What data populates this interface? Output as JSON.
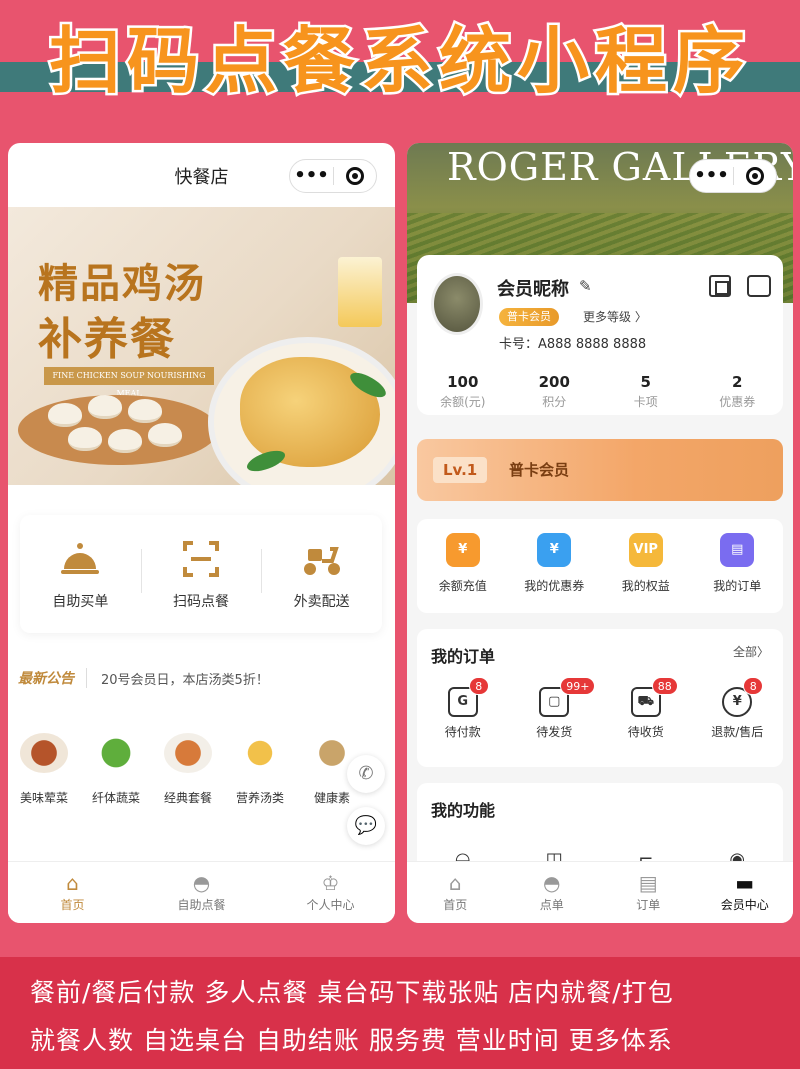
{
  "banner": {
    "title": "扫码点餐系统小程序"
  },
  "left_phone": {
    "title": "快餐店",
    "capsule": {
      "more_icon": "more-dots-icon",
      "close_icon": "target-icon"
    },
    "hero": {
      "line1": "精品鸡汤",
      "line2": "补养餐",
      "subtitle": "FINE CHICKEN SOUP NOURISHING MEAL"
    },
    "quick_actions": [
      {
        "label": "自助买单",
        "icon": "cloche-icon"
      },
      {
        "label": "扫码点餐",
        "icon": "scan-icon"
      },
      {
        "label": "外卖配送",
        "icon": "scooter-icon"
      }
    ],
    "notice": {
      "title": "最新公告",
      "text": "20号会员日，本店汤类5折！"
    },
    "categories": [
      {
        "label": "美味荤菜"
      },
      {
        "label": "纤体蔬菜"
      },
      {
        "label": "经典套餐"
      },
      {
        "label": "营养汤类"
      },
      {
        "label": "健康素"
      }
    ],
    "tabs": [
      {
        "label": "首页",
        "icon": "home-icon"
      },
      {
        "label": "自助点餐",
        "icon": "cloche-icon"
      },
      {
        "label": "个人中心",
        "icon": "crown-icon"
      }
    ]
  },
  "right_phone": {
    "hero_title": "ROGER GALLERY",
    "profile": {
      "nickname": "会员昵称",
      "level_badge": "普卡会员",
      "more_levels": "更多等级 〉",
      "card_no": "卡号：A888 8888 8888"
    },
    "stats": [
      {
        "value": "100",
        "label": "余额(元)"
      },
      {
        "value": "200",
        "label": "积分"
      },
      {
        "value": "5",
        "label": "卡项"
      },
      {
        "value": "2",
        "label": "优惠券"
      }
    ],
    "level_card": {
      "tag": "Lv.1",
      "name": "普卡会员"
    },
    "services": [
      {
        "label": "余额充值",
        "icon": "money-bag-icon",
        "color": "#f79a2e"
      },
      {
        "label": "我的优惠券",
        "icon": "coupon-icon",
        "color": "#3aa0f0"
      },
      {
        "label": "我的权益",
        "icon": "vip-icon",
        "color": "#f5b83a"
      },
      {
        "label": "我的订单",
        "icon": "order-card-icon",
        "color": "#7a6cf0"
      }
    ],
    "orders": {
      "title": "我的订单",
      "all_link": "全部〉",
      "items": [
        {
          "label": "待付款",
          "badge": "8",
          "icon": "wallet-icon"
        },
        {
          "label": "待发货",
          "badge": "99+",
          "icon": "package-icon"
        },
        {
          "label": "待收货",
          "badge": "88",
          "icon": "truck-icon"
        },
        {
          "label": "退款/售后",
          "badge": "8",
          "icon": "refund-icon"
        }
      ]
    },
    "functions": {
      "title": "我的功能"
    },
    "tabs": [
      {
        "label": "首页",
        "icon": "home-icon"
      },
      {
        "label": "点单",
        "icon": "cloche-icon"
      },
      {
        "label": "订单",
        "icon": "clipboard-icon"
      },
      {
        "label": "会员中心",
        "icon": "card-icon"
      }
    ]
  },
  "footer": {
    "line1": "餐前/餐后付款 多人点餐 桌台码下载张贴 店内就餐/打包",
    "line2": "就餐人数 自选桌台 自助结账 服务费 营业时间 更多体系"
  }
}
